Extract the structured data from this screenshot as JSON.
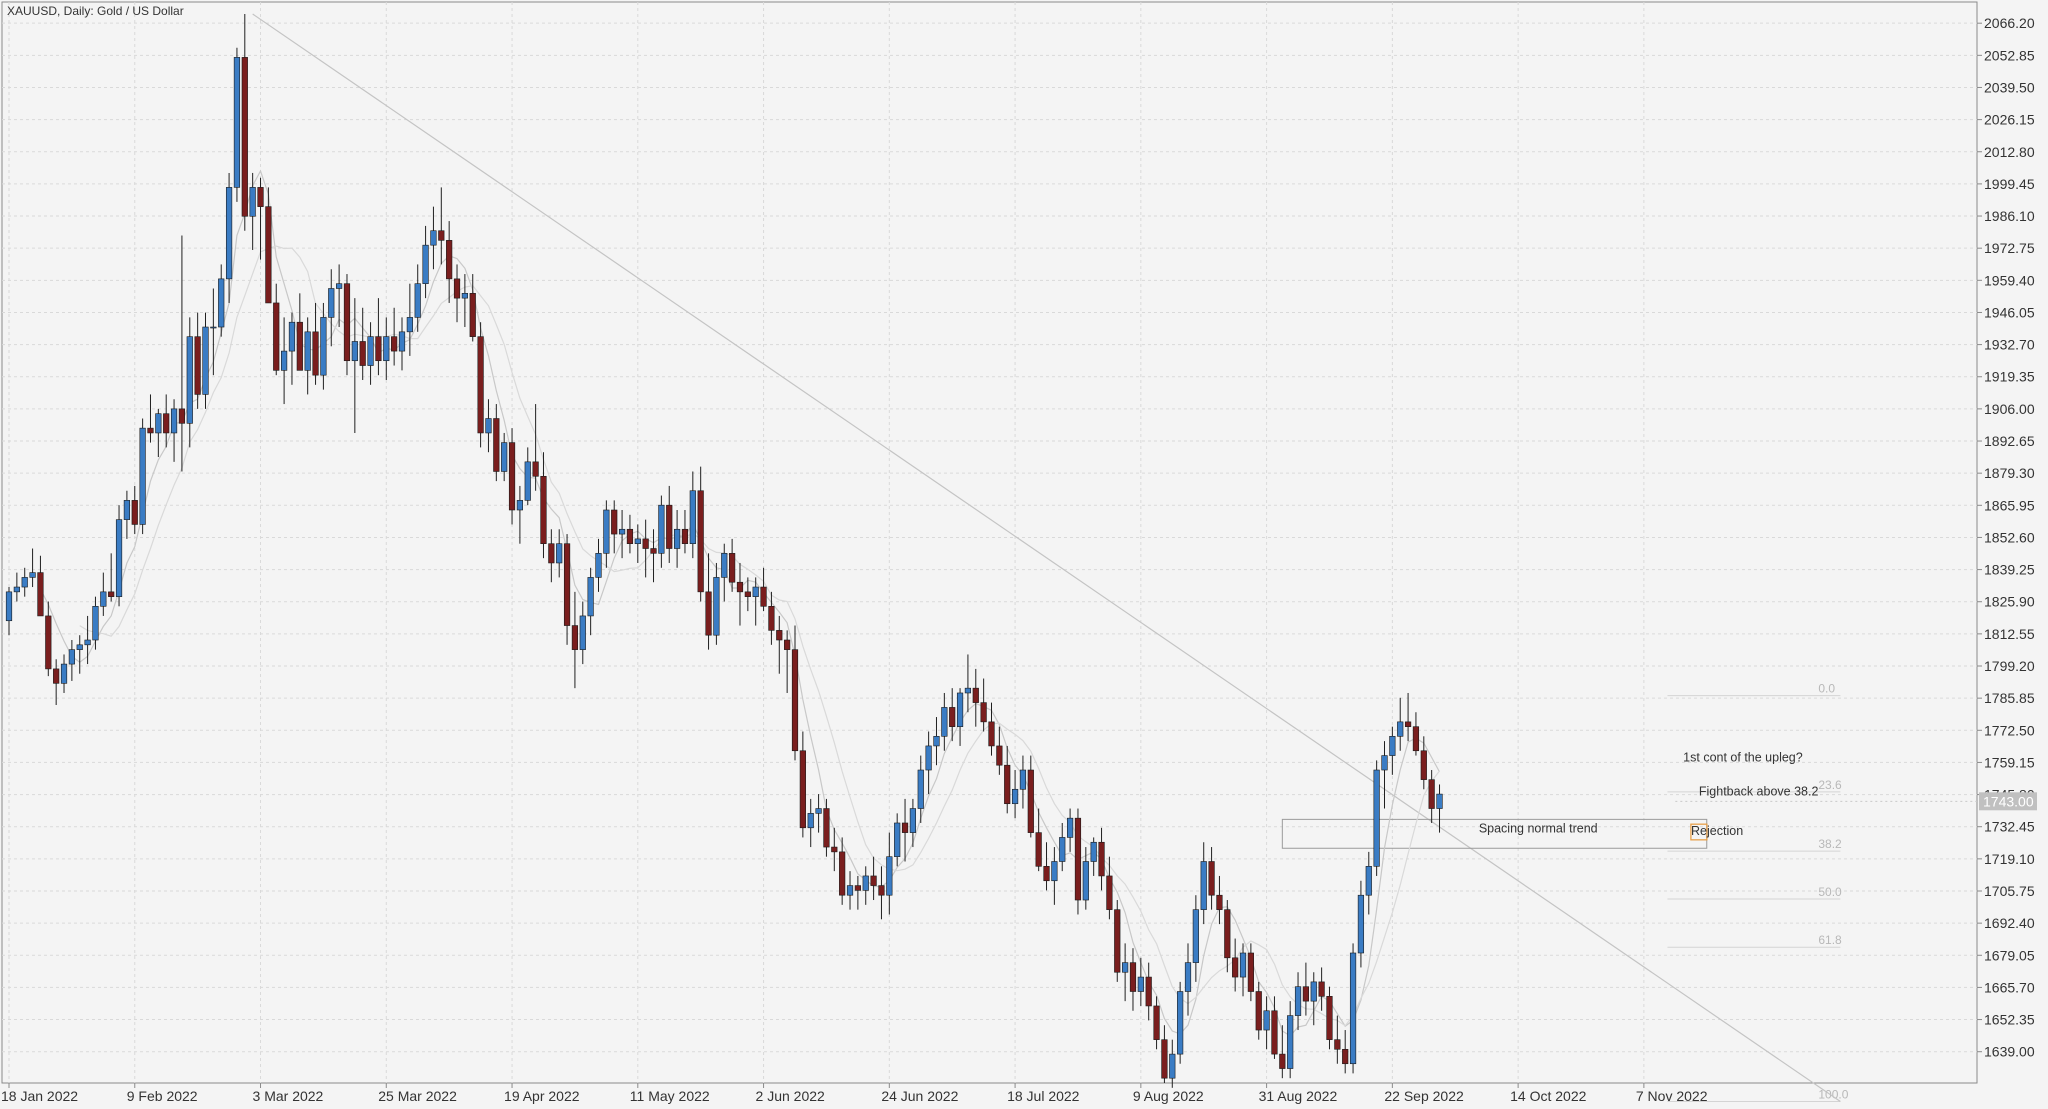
{
  "window": {
    "title": "XAUUSD, Daily:  Gold / US Dollar"
  },
  "colors": {
    "bull": "#3a7cc4",
    "bear": "#7a1e1e",
    "grid": "#d9d9d9",
    "axis": "#8a8a8a",
    "ma": "#c8c8c8",
    "trend": "#c4c4c4",
    "fib": "#d4d4d4",
    "rect": "#9a9a9a",
    "highlight": "#e8a04a",
    "background": "#f4f4f4"
  },
  "chart_data": {
    "type": "candlestick",
    "title": "XAUUSD, Daily:  Gold / US Dollar",
    "ylim": [
      1626.0,
      2075.0
    ],
    "grid": true,
    "y_ticks": [
      "2066.20",
      "2052.85",
      "2039.50",
      "2026.15",
      "2012.80",
      "1999.45",
      "1986.10",
      "1972.75",
      "1959.40",
      "1946.05",
      "1932.70",
      "1919.35",
      "1906.00",
      "1892.65",
      "1879.30",
      "1865.95",
      "1852.60",
      "1839.25",
      "1825.90",
      "1812.55",
      "1799.20",
      "1785.85",
      "1772.50",
      "1759.15",
      "1745.80",
      "1732.45",
      "1719.10",
      "1705.75",
      "1692.40",
      "1679.05",
      "1665.70",
      "1652.35",
      "1639.00"
    ],
    "x_ticks": [
      {
        "label": "18 Jan 2022",
        "index": 0
      },
      {
        "label": "9 Feb 2022",
        "index": 16
      },
      {
        "label": "3 Mar 2022",
        "index": 32
      },
      {
        "label": "25 Mar 2022",
        "index": 48
      },
      {
        "label": "19 Apr 2022",
        "index": 64
      },
      {
        "label": "11 May 2022",
        "index": 80
      },
      {
        "label": "2 Jun 2022",
        "index": 96
      },
      {
        "label": "24 Jun 2022",
        "index": 112
      },
      {
        "label": "18 Jul 2022",
        "index": 128
      },
      {
        "label": "9 Aug 2022",
        "index": 144
      },
      {
        "label": "31 Aug 2022",
        "index": 160
      },
      {
        "label": "22 Sep 2022",
        "index": 176
      },
      {
        "label": "14 Oct 2022",
        "index": 192
      },
      {
        "label": "7 Nov 2022",
        "index": 208
      }
    ],
    "current_price": "1743.00",
    "fibonacci": {
      "levels": [
        {
          "label": "0.0",
          "price": 1786.9
        },
        {
          "label": "23.6",
          "price": 1746.9
        },
        {
          "label": "38.2",
          "price": 1722.3
        },
        {
          "label": "50.0",
          "price": 1702.4
        },
        {
          "label": "61.8",
          "price": 1682.4
        },
        {
          "label": "100.0",
          "price": 1618.3
        }
      ]
    },
    "annotations": [
      {
        "text": "1st cont of the upleg?",
        "index": 213,
        "price": 1759.5
      },
      {
        "text": "Fightback above 38.2",
        "index": 215,
        "price": 1745.5
      },
      {
        "text": "Spacing normal trend",
        "index": 187,
        "price": 1730.0
      },
      {
        "text": "Rejection",
        "index": 214,
        "price": 1729.0
      }
    ],
    "candles": [
      [
        1818,
        1832,
        1812,
        1830
      ],
      [
        1830,
        1838,
        1826,
        1832
      ],
      [
        1832,
        1840,
        1828,
        1836
      ],
      [
        1836,
        1848,
        1832,
        1838
      ],
      [
        1838,
        1845,
        1824,
        1820
      ],
      [
        1820,
        1826,
        1795,
        1798
      ],
      [
        1798,
        1802,
        1783,
        1792
      ],
      [
        1792,
        1804,
        1788,
        1800
      ],
      [
        1800,
        1810,
        1793,
        1806
      ],
      [
        1806,
        1812,
        1796,
        1808
      ],
      [
        1808,
        1820,
        1800,
        1810
      ],
      [
        1810,
        1828,
        1806,
        1824
      ],
      [
        1824,
        1838,
        1820,
        1830
      ],
      [
        1830,
        1846,
        1826,
        1828
      ],
      [
        1828,
        1866,
        1824,
        1860
      ],
      [
        1860,
        1872,
        1852,
        1868
      ],
      [
        1868,
        1874,
        1854,
        1858
      ],
      [
        1858,
        1902,
        1854,
        1898
      ],
      [
        1898,
        1912,
        1892,
        1896
      ],
      [
        1896,
        1906,
        1886,
        1904
      ],
      [
        1904,
        1912,
        1890,
        1896
      ],
      [
        1896,
        1910,
        1884,
        1906
      ],
      [
        1906,
        1978,
        1880,
        1900
      ],
      [
        1900,
        1944,
        1890,
        1936
      ],
      [
        1936,
        1946,
        1906,
        1912
      ],
      [
        1912,
        1946,
        1906,
        1940
      ],
      [
        1940,
        1956,
        1920,
        1940
      ],
      [
        1940,
        1966,
        1936,
        1960
      ],
      [
        1960,
        2004,
        1950,
        1998
      ],
      [
        1998,
        2056,
        1992,
        2052
      ],
      [
        2052,
        2070,
        1980,
        1986
      ],
      [
        1986,
        2004,
        1972,
        1998
      ],
      [
        1998,
        2002,
        1968,
        1990
      ],
      [
        1990,
        1998,
        1950,
        1950
      ],
      [
        1950,
        1958,
        1920,
        1922
      ],
      [
        1922,
        1944,
        1908,
        1930
      ],
      [
        1930,
        1946,
        1916,
        1942
      ],
      [
        1942,
        1954,
        1930,
        1922
      ],
      [
        1922,
        1944,
        1912,
        1938
      ],
      [
        1938,
        1950,
        1916,
        1920
      ],
      [
        1920,
        1950,
        1914,
        1944
      ],
      [
        1944,
        1964,
        1932,
        1956
      ],
      [
        1956,
        1966,
        1940,
        1958
      ],
      [
        1958,
        1962,
        1920,
        1926
      ],
      [
        1926,
        1952,
        1896,
        1934
      ],
      [
        1934,
        1948,
        1918,
        1924
      ],
      [
        1924,
        1942,
        1916,
        1936
      ],
      [
        1936,
        1952,
        1920,
        1926
      ],
      [
        1926,
        1944,
        1918,
        1936
      ],
      [
        1936,
        1948,
        1924,
        1930
      ],
      [
        1930,
        1944,
        1922,
        1938
      ],
      [
        1938,
        1958,
        1928,
        1944
      ],
      [
        1944,
        1966,
        1938,
        1958
      ],
      [
        1958,
        1982,
        1952,
        1974
      ],
      [
        1974,
        1990,
        1964,
        1980
      ],
      [
        1980,
        1998,
        1966,
        1976
      ],
      [
        1976,
        1984,
        1950,
        1960
      ],
      [
        1960,
        1966,
        1942,
        1952
      ],
      [
        1952,
        1962,
        1940,
        1954
      ],
      [
        1954,
        1962,
        1934,
        1936
      ],
      [
        1936,
        1942,
        1890,
        1896
      ],
      [
        1896,
        1910,
        1888,
        1902
      ],
      [
        1902,
        1908,
        1876,
        1880
      ],
      [
        1880,
        1896,
        1876,
        1892
      ],
      [
        1892,
        1898,
        1858,
        1864
      ],
      [
        1864,
        1874,
        1850,
        1868
      ],
      [
        1868,
        1890,
        1866,
        1884
      ],
      [
        1884,
        1908,
        1872,
        1878
      ],
      [
        1878,
        1888,
        1844,
        1850
      ],
      [
        1850,
        1856,
        1834,
        1842
      ],
      [
        1842,
        1856,
        1836,
        1850
      ],
      [
        1850,
        1854,
        1808,
        1816
      ],
      [
        1816,
        1830,
        1790,
        1806
      ],
      [
        1806,
        1826,
        1800,
        1820
      ],
      [
        1820,
        1840,
        1812,
        1836
      ],
      [
        1836,
        1852,
        1830,
        1846
      ],
      [
        1846,
        1868,
        1840,
        1864
      ],
      [
        1864,
        1868,
        1846,
        1854
      ],
      [
        1854,
        1864,
        1844,
        1856
      ],
      [
        1856,
        1862,
        1846,
        1850
      ],
      [
        1850,
        1858,
        1842,
        1852
      ],
      [
        1852,
        1860,
        1836,
        1848
      ],
      [
        1848,
        1856,
        1834,
        1846
      ],
      [
        1846,
        1870,
        1840,
        1866
      ],
      [
        1866,
        1874,
        1842,
        1848
      ],
      [
        1848,
        1864,
        1840,
        1856
      ],
      [
        1856,
        1864,
        1846,
        1850
      ],
      [
        1850,
        1880,
        1844,
        1872
      ],
      [
        1872,
        1882,
        1826,
        1830
      ],
      [
        1830,
        1846,
        1806,
        1812
      ],
      [
        1812,
        1842,
        1808,
        1836
      ],
      [
        1836,
        1850,
        1826,
        1846
      ],
      [
        1846,
        1852,
        1830,
        1834
      ],
      [
        1834,
        1842,
        1816,
        1830
      ],
      [
        1830,
        1836,
        1822,
        1828
      ],
      [
        1828,
        1836,
        1816,
        1832
      ],
      [
        1832,
        1840,
        1822,
        1824
      ],
      [
        1824,
        1830,
        1808,
        1814
      ],
      [
        1814,
        1820,
        1796,
        1810
      ],
      [
        1810,
        1814,
        1788,
        1806
      ],
      [
        1806,
        1816,
        1760,
        1764
      ],
      [
        1764,
        1772,
        1728,
        1732
      ],
      [
        1732,
        1744,
        1724,
        1738
      ],
      [
        1738,
        1746,
        1730,
        1740
      ],
      [
        1740,
        1744,
        1720,
        1724
      ],
      [
        1724,
        1732,
        1714,
        1722
      ],
      [
        1722,
        1728,
        1700,
        1704
      ],
      [
        1704,
        1714,
        1698,
        1708
      ],
      [
        1708,
        1712,
        1698,
        1706
      ],
      [
        1706,
        1716,
        1700,
        1712
      ],
      [
        1712,
        1720,
        1702,
        1708
      ],
      [
        1708,
        1716,
        1694,
        1704
      ],
      [
        1704,
        1730,
        1696,
        1720
      ],
      [
        1720,
        1738,
        1716,
        1734
      ],
      [
        1734,
        1744,
        1718,
        1730
      ],
      [
        1730,
        1744,
        1724,
        1740
      ],
      [
        1740,
        1762,
        1734,
        1756
      ],
      [
        1756,
        1772,
        1746,
        1766
      ],
      [
        1766,
        1778,
        1758,
        1770
      ],
      [
        1770,
        1788,
        1764,
        1782
      ],
      [
        1782,
        1790,
        1768,
        1774
      ],
      [
        1774,
        1790,
        1766,
        1788
      ],
      [
        1788,
        1804,
        1780,
        1790
      ],
      [
        1790,
        1798,
        1774,
        1784
      ],
      [
        1784,
        1794,
        1772,
        1776
      ],
      [
        1776,
        1784,
        1762,
        1766
      ],
      [
        1766,
        1774,
        1754,
        1758
      ],
      [
        1758,
        1766,
        1738,
        1742
      ],
      [
        1742,
        1756,
        1736,
        1748
      ],
      [
        1748,
        1762,
        1740,
        1756
      ],
      [
        1756,
        1762,
        1728,
        1730
      ],
      [
        1730,
        1740,
        1714,
        1716
      ],
      [
        1716,
        1726,
        1706,
        1710
      ],
      [
        1710,
        1724,
        1700,
        1718
      ],
      [
        1718,
        1734,
        1714,
        1728
      ],
      [
        1728,
        1740,
        1722,
        1736
      ],
      [
        1736,
        1740,
        1696,
        1702
      ],
      [
        1702,
        1724,
        1698,
        1718
      ],
      [
        1718,
        1728,
        1712,
        1726
      ],
      [
        1726,
        1732,
        1706,
        1712
      ],
      [
        1712,
        1720,
        1694,
        1698
      ],
      [
        1698,
        1702,
        1668,
        1672
      ],
      [
        1672,
        1684,
        1660,
        1676
      ],
      [
        1676,
        1682,
        1656,
        1664
      ],
      [
        1664,
        1678,
        1658,
        1670
      ],
      [
        1670,
        1676,
        1652,
        1658
      ],
      [
        1658,
        1662,
        1640,
        1644
      ],
      [
        1644,
        1650,
        1626,
        1628
      ],
      [
        1628,
        1644,
        1624,
        1638
      ],
      [
        1638,
        1668,
        1634,
        1664
      ],
      [
        1664,
        1684,
        1654,
        1676
      ],
      [
        1676,
        1704,
        1668,
        1698
      ],
      [
        1698,
        1726,
        1692,
        1718
      ],
      [
        1718,
        1724,
        1698,
        1704
      ],
      [
        1704,
        1712,
        1692,
        1698
      ],
      [
        1698,
        1702,
        1672,
        1678
      ],
      [
        1678,
        1686,
        1664,
        1670
      ],
      [
        1670,
        1684,
        1662,
        1680
      ],
      [
        1680,
        1684,
        1660,
        1664
      ],
      [
        1664,
        1668,
        1644,
        1648
      ],
      [
        1648,
        1662,
        1640,
        1656
      ],
      [
        1656,
        1662,
        1636,
        1638
      ],
      [
        1638,
        1650,
        1628,
        1632
      ],
      [
        1632,
        1660,
        1628,
        1654
      ],
      [
        1654,
        1672,
        1648,
        1666
      ],
      [
        1666,
        1676,
        1654,
        1660
      ],
      [
        1660,
        1672,
        1650,
        1668
      ],
      [
        1668,
        1674,
        1656,
        1662
      ],
      [
        1662,
        1666,
        1640,
        1644
      ],
      [
        1644,
        1654,
        1634,
        1640
      ],
      [
        1640,
        1648,
        1630,
        1634
      ],
      [
        1634,
        1684,
        1630,
        1680
      ],
      [
        1680,
        1710,
        1674,
        1704
      ],
      [
        1704,
        1722,
        1696,
        1716
      ],
      [
        1716,
        1760,
        1712,
        1756
      ],
      [
        1756,
        1768,
        1740,
        1762
      ],
      [
        1762,
        1774,
        1754,
        1770
      ],
      [
        1770,
        1786,
        1764,
        1776
      ],
      [
        1776,
        1788,
        1768,
        1774
      ],
      [
        1774,
        1780,
        1762,
        1764
      ],
      [
        1764,
        1770,
        1748,
        1752
      ],
      [
        1752,
        1756,
        1734,
        1740
      ],
      [
        1740,
        1750,
        1730,
        1746
      ]
    ]
  }
}
